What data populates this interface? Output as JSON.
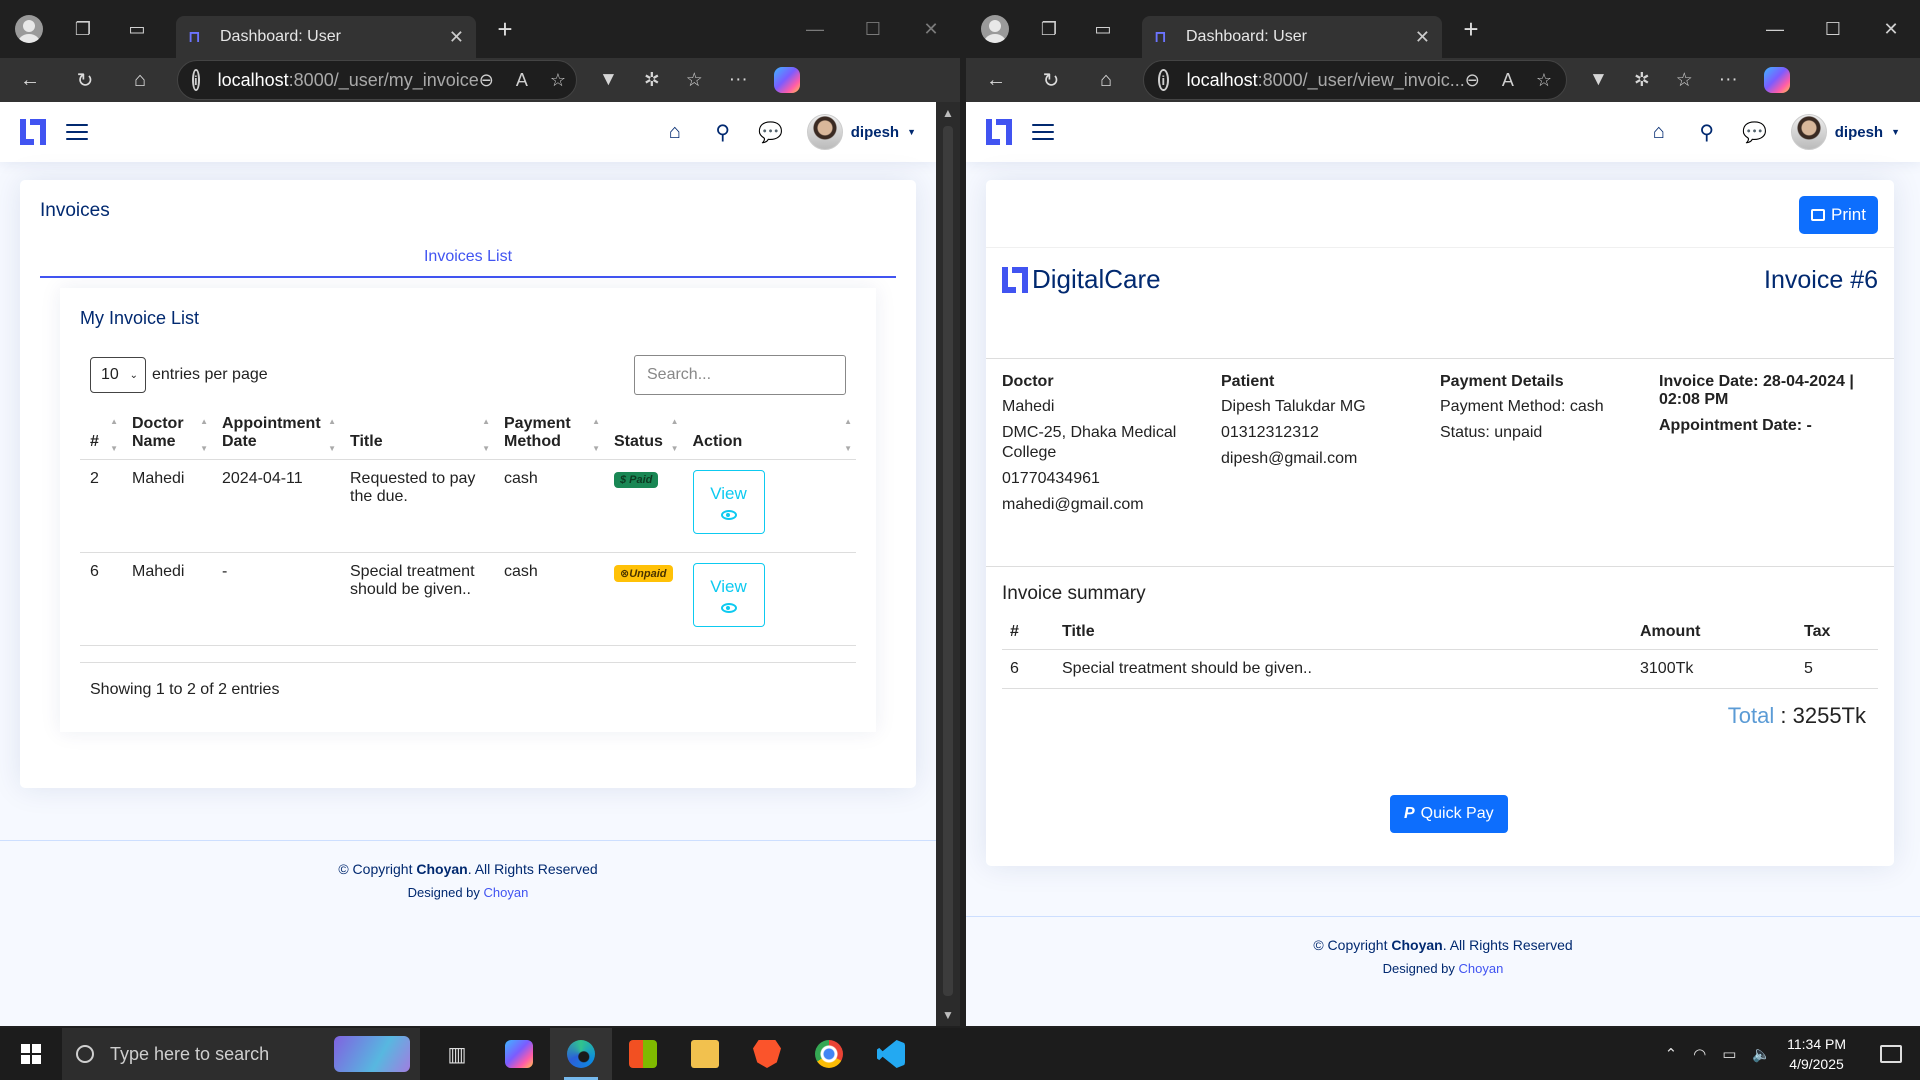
{
  "left_window": {
    "tab_title": "Dashboard: User",
    "url_host": "localhost",
    "url_path": ":8000/_user/my_invoice",
    "header": {
      "username": "dipesh"
    },
    "page": {
      "card_title": "Invoices",
      "subtab": "Invoices List",
      "list_title": "My Invoice List",
      "entries_value": "10",
      "entries_label": "entries per page",
      "search_placeholder": "Search...",
      "columns": [
        "#",
        "Doctor Name",
        "Appointment Date",
        "Title",
        "Payment Method",
        "Status",
        "Action"
      ],
      "rows": [
        {
          "num": "2",
          "doctor": "Mahedi",
          "date": "2024-04-11",
          "title": "Requested to pay the due.",
          "method": "cash",
          "status": "$ Paid",
          "status_kind": "paid",
          "action": "View"
        },
        {
          "num": "6",
          "doctor": "Mahedi",
          "date": "-",
          "title": "Special treatment should be given..",
          "method": "cash",
          "status": "⊗Unpaid",
          "status_kind": "unpaid",
          "action": "View"
        }
      ],
      "info": "Showing 1 to 2 of 2 entries"
    },
    "footer": {
      "copyright_prefix": "© Copyright ",
      "brand": "Choyan",
      "copyright_suffix": ". All Rights Reserved",
      "designed_prefix": "Designed by ",
      "designer": "Choyan"
    }
  },
  "right_window": {
    "tab_title": "Dashboard: User",
    "url_host": "localhost",
    "url_path": ":8000/_user/view_invoic...",
    "header": {
      "username": "dipesh"
    },
    "invoice": {
      "print_label": "Print",
      "brand": "DigitalCare",
      "number": "Invoice #6",
      "doctor": {
        "heading": "Doctor",
        "name": "Mahedi",
        "address": "DMC-25, Dhaka Medical College",
        "phone": "01770434961",
        "email": "mahedi@gmail.com"
      },
      "patient": {
        "heading": "Patient",
        "name": "Dipesh Talukdar MG",
        "phone": "01312312312",
        "email": "dipesh@gmail.com"
      },
      "payment": {
        "heading": "Payment Details",
        "method": "Payment Method: cash",
        "status": "Status: unpaid"
      },
      "meta": {
        "invoice_date": "Invoice Date: 28-04-2024 | 02:08 PM",
        "appointment_date": "Appointment Date: -"
      },
      "summary_title": "Invoice summary",
      "summary_columns": [
        "#",
        "Title",
        "Amount",
        "Tax"
      ],
      "summary_rows": [
        {
          "num": "6",
          "title": "Special treatment should be given..",
          "amount": "3100Tk",
          "tax": "5"
        }
      ],
      "total_label": "Total",
      "total_value": ": 3255Tk",
      "pay_label": "Quick Pay"
    },
    "footer": {
      "copyright_prefix": "© Copyright ",
      "brand": "Choyan",
      "copyright_suffix": ". All Rights Reserved",
      "designed_prefix": "Designed by ",
      "designer": "Choyan"
    }
  },
  "taskbar": {
    "search_placeholder": "Type here to search",
    "time": "11:34 PM",
    "date": "4/9/2025"
  },
  "colors": {
    "brand": "#4154f1",
    "navy": "#012970",
    "primary_button": "#0d6efd",
    "info": "#0dcaf0"
  }
}
